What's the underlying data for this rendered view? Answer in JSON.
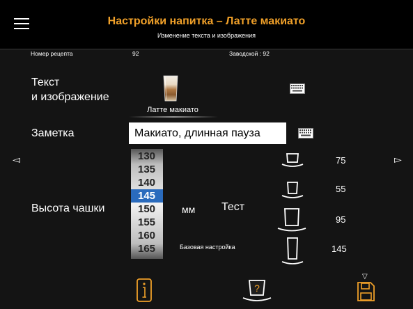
{
  "header": {
    "title": "Настройки напитка – Латте макиато",
    "subtitle": "Изменение текста и изображения"
  },
  "info": {
    "recipe_label": "Номер рецепта",
    "recipe_value": "92",
    "factory": "Заводской : 92"
  },
  "text_image": {
    "label_line1": "Текст",
    "label_line2": "и изображение",
    "drink_name": "Латте макиато"
  },
  "note": {
    "label": "Заметка",
    "value": "Макиато, длинная пауза"
  },
  "cup_height": {
    "label": "Высота чашки",
    "unit": "мм",
    "test_label": "Тест",
    "base_setting": "Базовая настройка",
    "options": [
      "130",
      "135",
      "140",
      "145",
      "150",
      "155",
      "160",
      "165"
    ],
    "selected": "145"
  },
  "cup_sizes": [
    {
      "icon": "small-cup-icon",
      "value": "75"
    },
    {
      "icon": "espresso-cup-icon",
      "value": "55"
    },
    {
      "icon": "large-cup-icon",
      "value": "95"
    },
    {
      "icon": "tall-glass-icon",
      "value": "145"
    }
  ],
  "colors": {
    "accent": "#f0a029",
    "background": "#141414",
    "selected": "#2a6bbd"
  }
}
